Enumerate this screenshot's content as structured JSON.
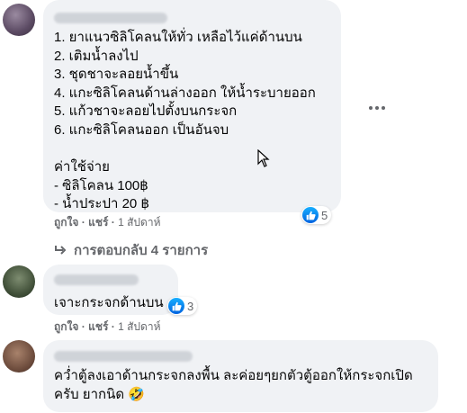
{
  "comments": [
    {
      "lines": [
        "1. ยาแนวซิลิโคลนให้ทั่ว เหลือไว้แค่ด้านบน",
        "2. เติมน้ำลงไป",
        "3. ชุดชาจะลอยน้ำขึ้น",
        "4. แกะซิลิโคลนด้านล่างออก ให้น้ำระบายออก",
        "5. แก้วชาจะลอยไปตั้งบนกระจก",
        "6. แกะซิลิโคลนออก เป็นอันจบ",
        "",
        "ค่าใช้จ่าย",
        "- ซิลิโคลน 100฿",
        "- น้ำประปา 20 ฿"
      ],
      "like_label": "ถูกใจ",
      "reply_label": "แชร์",
      "time": "1 สัปดาห์",
      "reaction_count": "5",
      "replies_label": "การตอบกลับ 4 รายการ"
    },
    {
      "lines": [
        "เจาะกระจกด้านบน"
      ],
      "like_label": "ถูกใจ",
      "reply_label": "แชร์",
      "time": "1 สัปดาห์",
      "reaction_count": "3"
    },
    {
      "lines": [
        "คว่ำตู้ลงเอาด้านกระจกลงพื้น ละค่อยๆยกตัวตู้ออกให้กระจกเปิด",
        "ครับ ยากนิด 🤣"
      ]
    }
  ],
  "icons": {
    "like": "thumbs-up-icon",
    "more": "more-options-icon",
    "reply_arrow": "reply-arrow-icon",
    "cursor": "mouse-cursor-icon",
    "emoji": "rolling-laughing-emoji"
  },
  "colors": {
    "bubble": "#f0f2f5",
    "meta": "#65676b",
    "like_gradient_top": "#18afff",
    "like_gradient_bottom": "#0062df"
  }
}
